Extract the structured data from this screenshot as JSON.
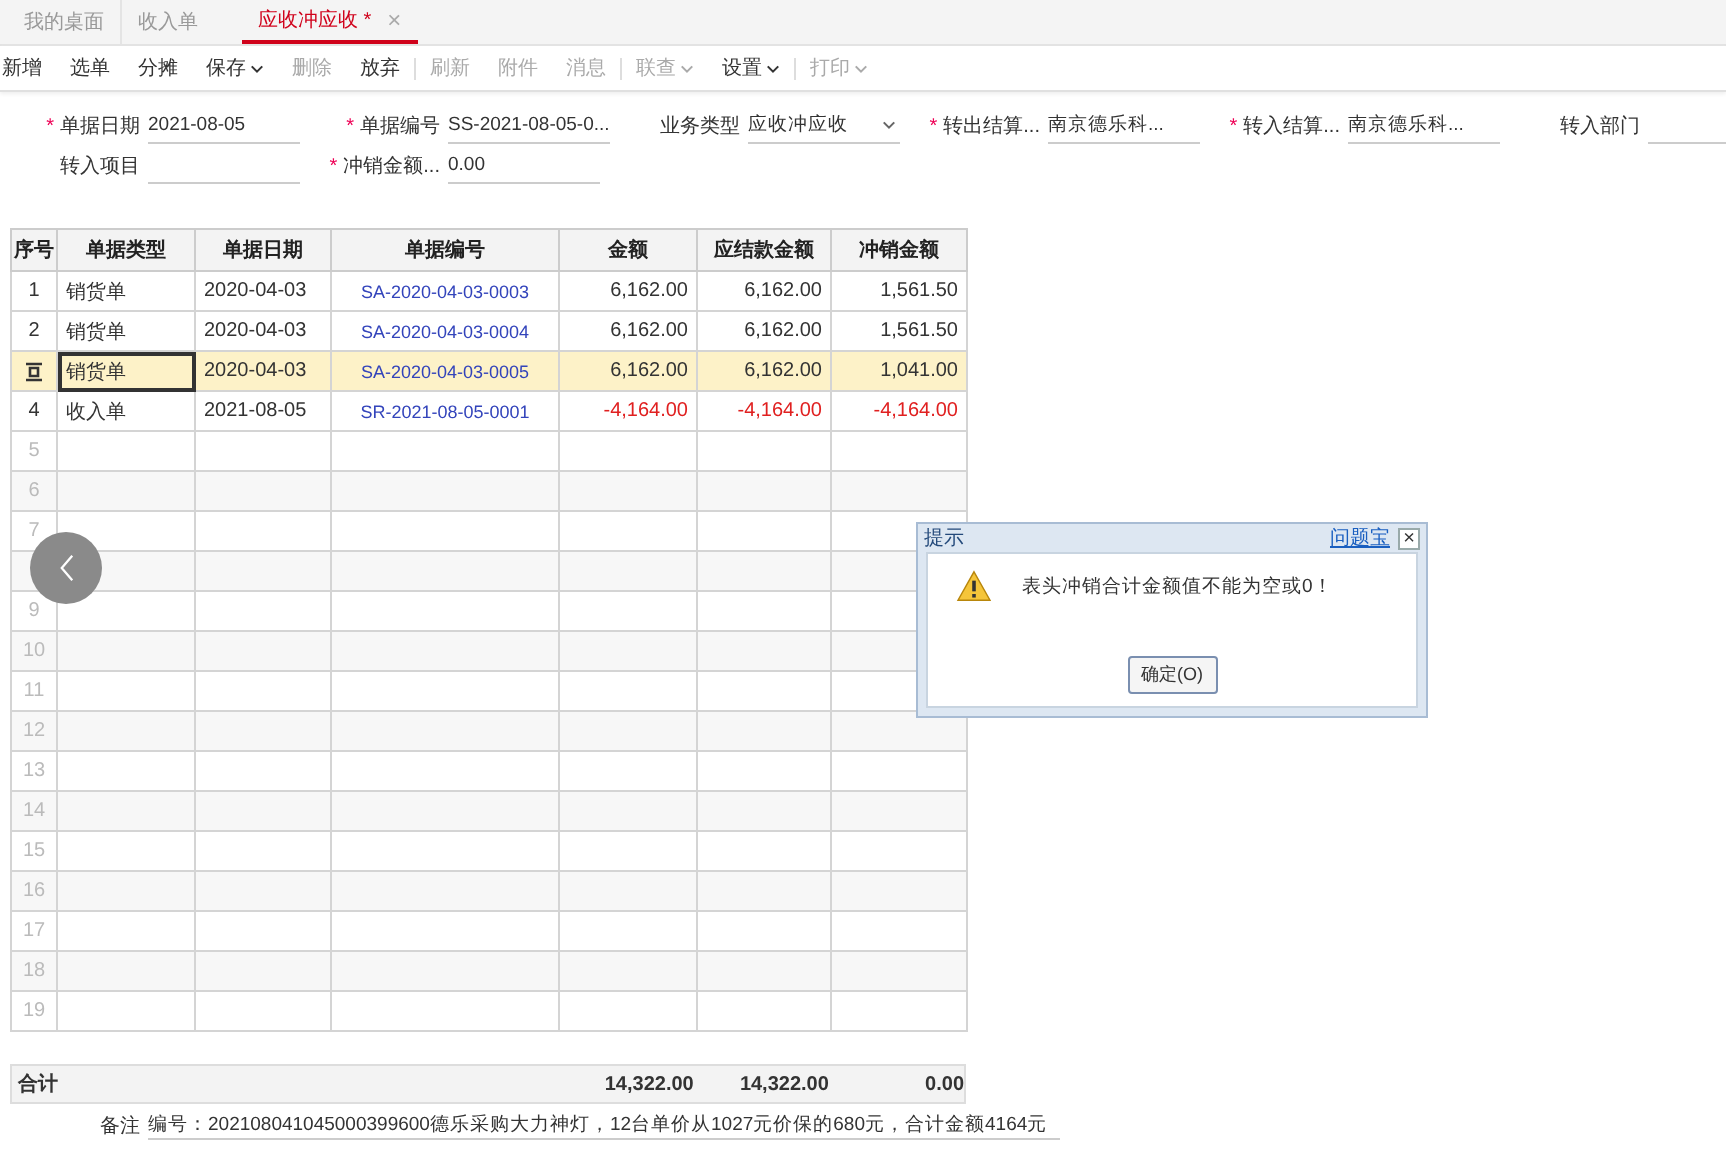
{
  "tabs": [
    {
      "label": "我的桌面",
      "selected": false
    },
    {
      "label": "收入单",
      "selected": false
    },
    {
      "label": "应收冲应收 *",
      "selected": true,
      "close": "×"
    }
  ],
  "toolbar": [
    {
      "label": "新增",
      "disabled": false,
      "dropdown": false,
      "separator_after": false
    },
    {
      "label": "选单",
      "disabled": false,
      "dropdown": false,
      "separator_after": false
    },
    {
      "label": "分摊",
      "disabled": false,
      "dropdown": false,
      "separator_after": false
    },
    {
      "label": "保存",
      "disabled": false,
      "dropdown": true,
      "separator_after": false
    },
    {
      "label": "删除",
      "disabled": true,
      "dropdown": false,
      "separator_after": false
    },
    {
      "label": "放弃",
      "disabled": false,
      "dropdown": false,
      "separator_after": true
    },
    {
      "label": "刷新",
      "disabled": true,
      "dropdown": false,
      "separator_after": false
    },
    {
      "label": "附件",
      "disabled": true,
      "dropdown": false,
      "separator_after": false
    },
    {
      "label": "消息",
      "disabled": true,
      "dropdown": false,
      "separator_after": true
    },
    {
      "label": "联查",
      "disabled": true,
      "dropdown": true,
      "separator_after": false
    },
    {
      "label": "设置",
      "disabled": false,
      "dropdown": true,
      "separator_after": true
    },
    {
      "label": "打印",
      "disabled": true,
      "dropdown": true,
      "separator_after": false
    }
  ],
  "form_rows": [
    [
      {
        "label": "单据日期",
        "required_mark": "*",
        "value": "2021-08-05",
        "kind": "text"
      },
      {
        "label": "单据编号",
        "required_mark": "*",
        "value": "SS-2021-08-05-0...",
        "kind": "text"
      },
      {
        "label": "业务类型",
        "value": "应收冲应收",
        "kind": "select"
      },
      {
        "label": "转出结算...",
        "required_mark": "*",
        "value": "南京德乐科...",
        "kind": "text"
      },
      {
        "label": "转入结算...",
        "required_mark": "*",
        "value": "南京德乐科...",
        "kind": "text"
      },
      {
        "label": "转入部门",
        "kind": "text"
      }
    ],
    [
      {
        "label": "转入项目",
        "kind": "text"
      },
      {
        "label": "冲销金额...",
        "required_mark": "*",
        "value": "0.00",
        "kind": "text"
      }
    ]
  ],
  "table": {
    "columns": [
      "序号",
      "单据类型",
      "单据日期",
      "单据编号",
      "金额",
      "应结款金额",
      "冲销金额"
    ],
    "rows": [
      {
        "no": "1",
        "type": "销货单",
        "date": "2020-04-03",
        "number": "SA-2020-04-03-0003",
        "amount": "6,162.00",
        "due": "6,162.00",
        "writeoff": "1,561.50",
        "selected": false,
        "negative": false
      },
      {
        "no": "2",
        "type": "销货单",
        "date": "2020-04-03",
        "number": "SA-2020-04-03-0004",
        "amount": "6,162.00",
        "due": "6,162.00",
        "writeoff": "1,561.50",
        "selected": false,
        "negative": false
      },
      {
        "type": "销货单",
        "date": "2020-04-03",
        "number": "SA-2020-04-03-0005",
        "amount": "6,162.00",
        "due": "6,162.00",
        "writeoff": "1,041.00",
        "selected": true,
        "negative": false
      },
      {
        "no": "4",
        "type": "收入单",
        "date": "2021-08-05",
        "number": "SR-2021-08-05-0001",
        "amount": "-4,164.00",
        "due": "-4,164.00",
        "writeoff": "-4,164.00",
        "selected": false,
        "negative": true
      },
      {
        "no": "5",
        "selected": false
      },
      {
        "no": "6",
        "selected": false
      },
      {
        "no": "7",
        "selected": false
      },
      {
        "selected": false
      },
      {
        "no": "9",
        "selected": false
      },
      {
        "no": "10",
        "selected": false
      },
      {
        "no": "11",
        "selected": false
      },
      {
        "no": "12",
        "selected": false
      },
      {
        "no": "13",
        "selected": false
      },
      {
        "no": "14",
        "selected": false
      },
      {
        "no": "15",
        "selected": false
      },
      {
        "no": "16",
        "selected": false
      },
      {
        "no": "17",
        "selected": false
      },
      {
        "no": "18",
        "selected": false
      },
      {
        "no": "19",
        "selected": false
      }
    ],
    "totals": {
      "label": "合计",
      "amount": "14,322.00",
      "due": "14,322.00",
      "writeoff": "0.00"
    }
  },
  "remark": {
    "label": "备注",
    "value": "编号：202108041045000399600德乐采购大力神灯，12台单价从1027元价保的680元，合计金额4164元"
  },
  "dialog": {
    "title": "提示",
    "help_link": "问题宝",
    "close": "×",
    "message": "表头冲销合计金额值不能为空或0！",
    "button": "确定(O)"
  }
}
